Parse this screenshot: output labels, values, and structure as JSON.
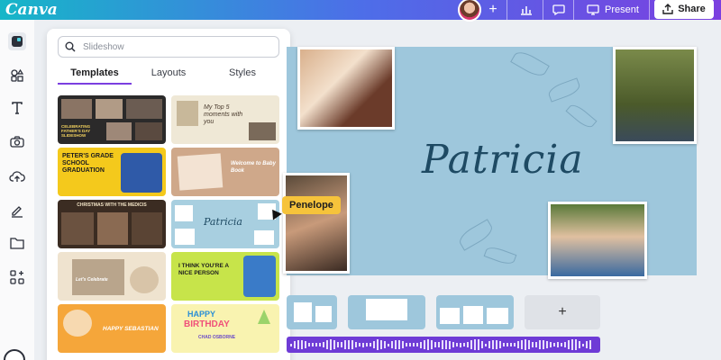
{
  "app": {
    "logo": "Canva"
  },
  "toolbar": {
    "add_label": "+",
    "present_label": "Present",
    "share_label": "Share"
  },
  "rail": {
    "icons": [
      "design-icon",
      "elements-icon",
      "text-icon",
      "brand-icon",
      "uploads-icon",
      "draw-icon",
      "projects-icon",
      "apps-icon"
    ]
  },
  "panel": {
    "search": {
      "placeholder": "Slideshow",
      "value": ""
    },
    "tabs": [
      "Templates",
      "Layouts",
      "Styles"
    ],
    "templates": [
      {
        "name": "Celebrating Father's Day Slideshow",
        "text": "CELEBRATING FATHER'S DAY SLIDESHOW",
        "bg": "#2b2a2a"
      },
      {
        "name": "My Top 5 Moments with You",
        "text": "My Top 5 moments with you",
        "bg": "#efe8d6"
      },
      {
        "name": "Peter's Grade School Graduation",
        "text": "PETER'S GRADE SCHOOL GRADUATION",
        "bg": "#f4c91c"
      },
      {
        "name": "Welcome to Baby Book",
        "text": "Welcome to Baby Book",
        "bg": "#cfa88a"
      },
      {
        "name": "Christmas with the Medicis",
        "text": "CHRISTMAS WITH THE MEDICIS",
        "bg": "#3b2c22"
      },
      {
        "name": "Patricia",
        "text": "Patricia",
        "bg": "#a8cfe0"
      },
      {
        "name": "Let's Celebrate Patricia",
        "text": "Let's Celebrate",
        "bg": "#efe3cf"
      },
      {
        "name": "I Think You're a Nice Person",
        "text": "I THINK YOU'RE A NICE PERSON",
        "bg": "#c7e44a"
      },
      {
        "name": "Happy Birthday Sebastian",
        "text": "HAPPY SEBASTIAN",
        "bg": "#f5a63a"
      },
      {
        "name": "Happy Birthday Chad Osborne",
        "text_a": "HAPPY",
        "text_b": "BIRTHDAY",
        "text_c": "CHAD OSBORNE",
        "bg": "#f9f3b0"
      }
    ]
  },
  "canvas": {
    "title": "Patricia",
    "bg": "#9ec7dc"
  },
  "collaborator": {
    "name": "Penelope",
    "color": "#f6c33b"
  },
  "pages": {
    "add_label": "+"
  },
  "colors": {
    "accent": "#7b3fe0",
    "audio": "#6e3bd6"
  }
}
